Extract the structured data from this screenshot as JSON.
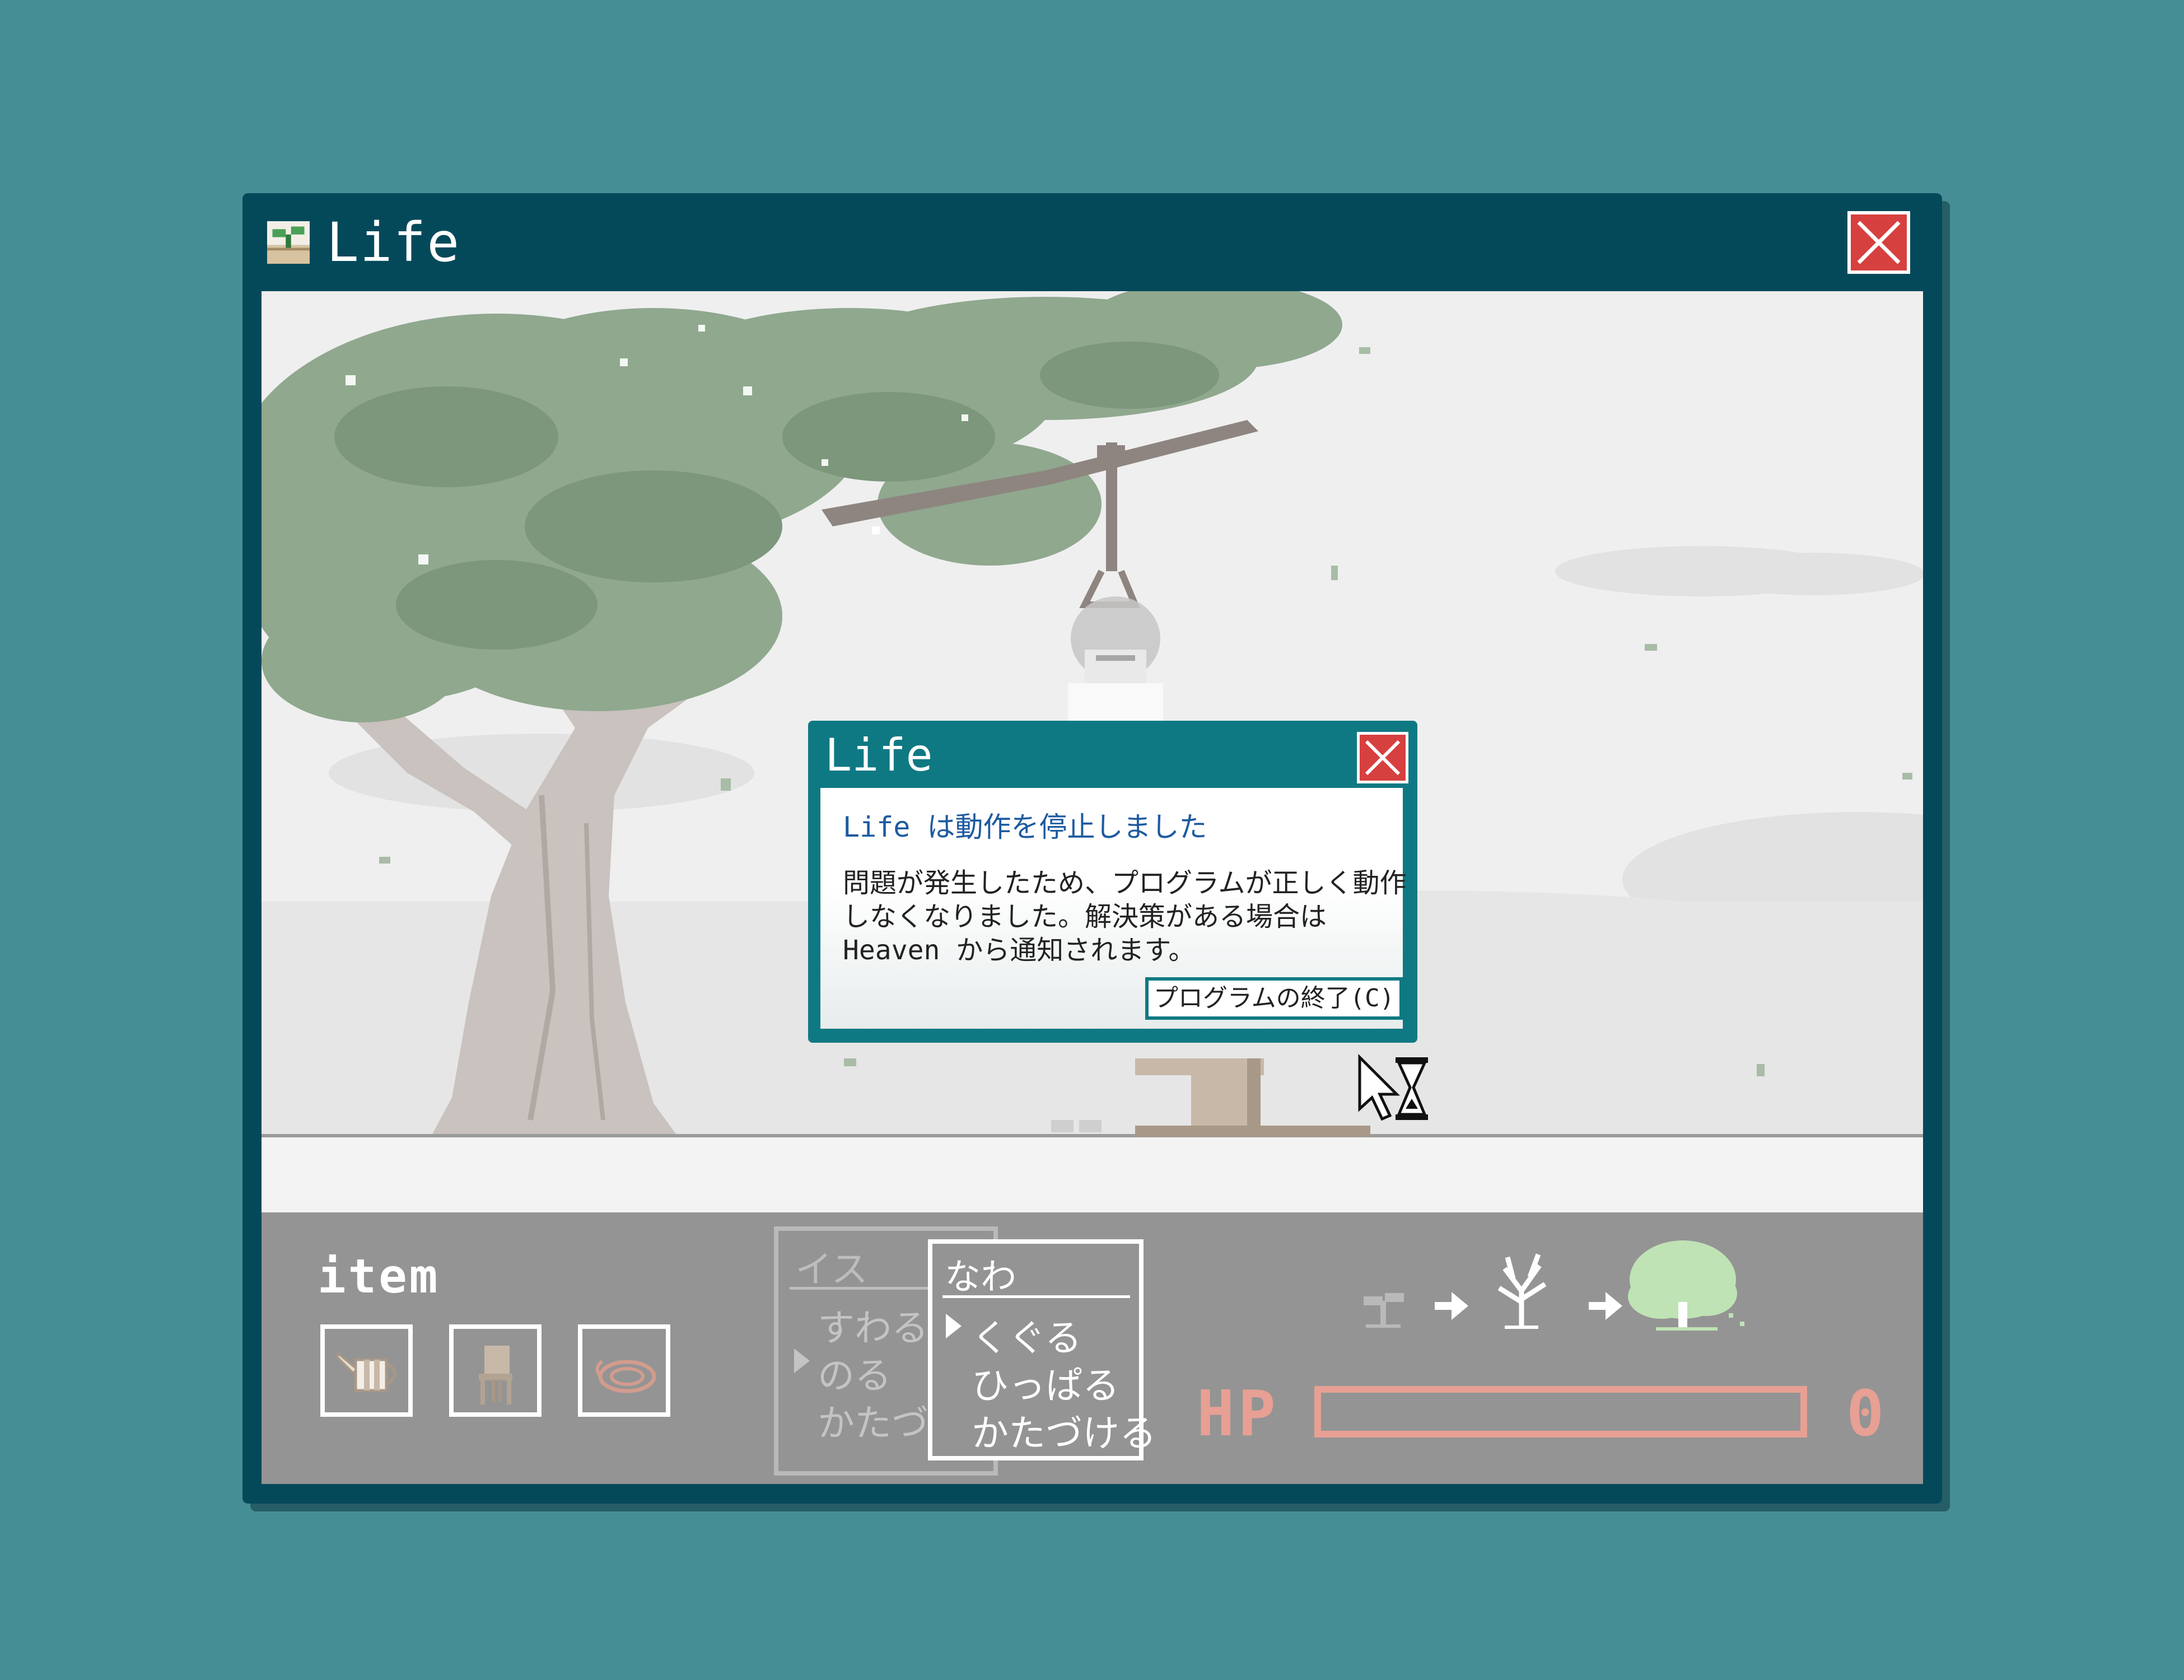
{
  "window": {
    "title": "Life",
    "icon": "sprout-icon",
    "close_icon": "close-icon"
  },
  "scene": {
    "description_icons": [
      "tree",
      "rope-noose",
      "character",
      "fallen-chair",
      "shoes"
    ]
  },
  "hud": {
    "item_label": "item",
    "items": [
      {
        "name": "watering-can-icon"
      },
      {
        "name": "chair-icon"
      },
      {
        "name": "rope-icon"
      }
    ],
    "menu_back": {
      "title": "イス",
      "items": [
        "すわる",
        "のる",
        "かたづけ"
      ],
      "selected_index": 1
    },
    "menu_front": {
      "title": "なわ",
      "items": [
        "くぐる",
        "ひっぱる",
        "かたづける"
      ],
      "selected_index": 0
    },
    "growth": [
      "sprout-icon",
      "arrow-right-icon",
      "bare-tree-icon",
      "arrow-right-icon",
      "green-tree-icon"
    ],
    "hp": {
      "label": "HP",
      "value": "0",
      "fraction": 0.0
    }
  },
  "dialog": {
    "title": "Life",
    "heading": "Life は動作を停止しました",
    "lines": [
      "問題が発生したため、プログラムが正しく動作",
      "しなくなりました。解決策がある場合は",
      "Heaven から通知されます。"
    ],
    "button_label": "プログラムの終了(C)"
  },
  "colors": {
    "background": "#468e96",
    "window_frame": "#04495a",
    "dialog_frame": "#0f7983",
    "close_red": "#d6403f",
    "hud_gray": "#949494",
    "hp_color": "#e7a093"
  }
}
